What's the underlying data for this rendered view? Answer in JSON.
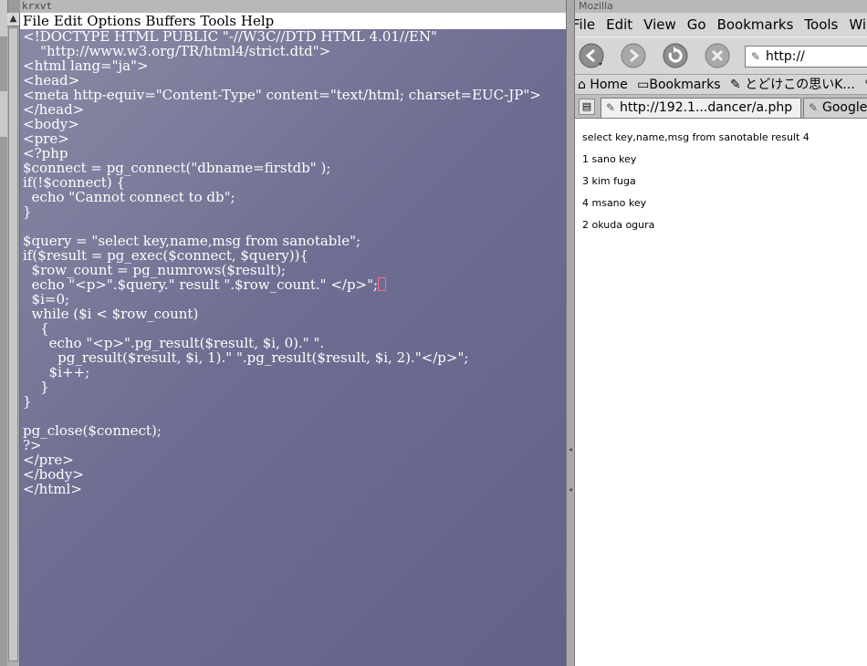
{
  "terminal": {
    "title": "krxvt",
    "menu": [
      "File",
      "Edit",
      "Options",
      "Buffers",
      "Tools",
      "Help"
    ],
    "lines": [
      "<!DOCTYPE HTML PUBLIC \"-//W3C//DTD HTML 4.01//EN\"",
      "    \"http://www.w3.org/TR/html4/strict.dtd\">",
      "<html lang=\"ja\">",
      "<head>",
      "<meta http-equiv=\"Content-Type\" content=\"text/html; charset=EUC-JP\">",
      "</head>",
      "<body>",
      "<pre>",
      "<?php",
      "$connect = pg_connect(\"dbname=firstdb\" );",
      "if(!$connect) {",
      "  echo \"Cannot connect to db\";",
      "}",
      "",
      "$query = \"select key,name,msg from sanotable\";",
      "if($result = pg_exec($connect, $query)){",
      "  $row_count = pg_numrows($result);",
      "  echo \"<p>\".$query.\" result \".$row_count.\" </p>\";",
      "  $i=0;",
      "  while ($i < $row_count)",
      "    {",
      "      echo \"<p>\".pg_result($result, $i, 0).\" \".",
      "        pg_result($result, $i, 1).\" \".pg_result($result, $i, 2).\"</p>\";",
      "      $i++;",
      "    }",
      "}",
      "",
      "pg_close($connect);",
      "?>",
      "</pre>",
      "</body>",
      "</html>"
    ],
    "cursor_line": 17
  },
  "browser": {
    "title": "Mozilla",
    "menu": [
      "File",
      "Edit",
      "View",
      "Go",
      "Bookmarks",
      "Tools",
      "Window"
    ],
    "url": "http://",
    "bookmarks": [
      "Home",
      "Bookmarks",
      "とどけこの思いK...",
      ""
    ],
    "tabs": [
      {
        "label": "http://192.1...dancer/a.php",
        "active": true
      },
      {
        "label": "Google 検索",
        "active": false
      }
    ],
    "content_lines": [
      "select key,name,msg from sanotable result 4",
      "1 sano key",
      "3 kim fuga",
      "4 msano key",
      "2 okuda ogura"
    ]
  }
}
